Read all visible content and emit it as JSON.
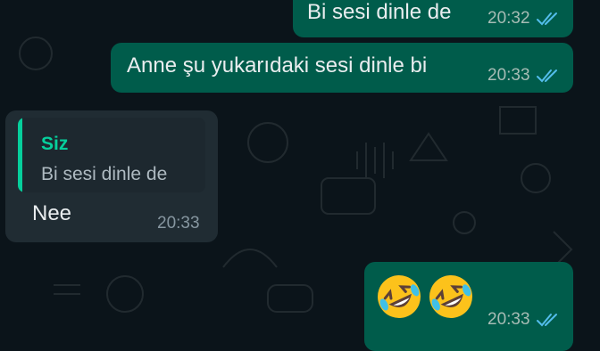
{
  "messages": [
    {
      "direction": "outgoing",
      "text": "Bi sesi dinle de",
      "time": "20:32",
      "status_icon": "double-check-read"
    },
    {
      "direction": "outgoing",
      "text": "Anne şu yukarıdaki sesi dinle bi",
      "time": "20:33",
      "status_icon": "double-check-read"
    },
    {
      "direction": "incoming",
      "quote": {
        "author": "Siz",
        "text": "Bi sesi dinle de"
      },
      "text": "Nee",
      "time": "20:33"
    },
    {
      "direction": "outgoing",
      "emoji": [
        "rolling-on-floor-laughing",
        "rolling-on-floor-laughing"
      ],
      "time": "20:33",
      "status_icon": "double-check-read"
    }
  ],
  "colors": {
    "background": "#0b141a",
    "outgoing_bubble": "#005c4b",
    "incoming_bubble": "#202c33",
    "read_tick": "#53bdeb",
    "quote_accent": "#06cf9c"
  }
}
